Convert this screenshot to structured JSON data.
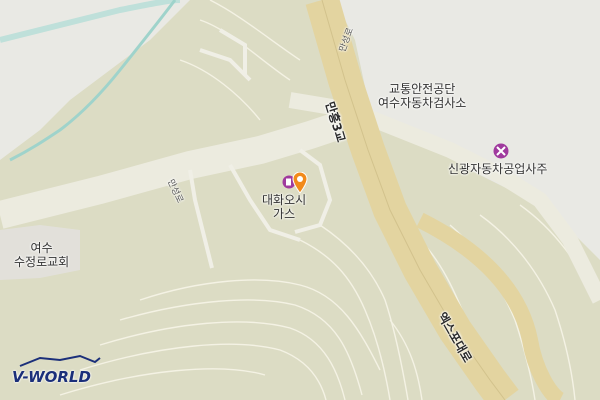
{
  "map": {
    "pois": {
      "agency": {
        "line1": "교통안전공단",
        "line2": "여수자동차검사소"
      },
      "repair": {
        "label": "신광자동차공업사주"
      },
      "gas": {
        "line1": "대화오시",
        "line2": "가스"
      },
      "church": {
        "line1": "여수",
        "line2": "수정로교회"
      }
    },
    "roads": {
      "bridge": "만흥3교",
      "expo": "엑스포대로",
      "mancheong_top": "만성로",
      "mancheong_mid": "만성로"
    },
    "icons": {
      "repair": "wrench-cross-icon",
      "gas": "gas-station-icon",
      "location": "location-pin-icon"
    },
    "colors": {
      "land": "#dcdcc4",
      "urban": "#e9e9e4",
      "water": "#9fd3cb",
      "expressway": "#e3d4a0",
      "minor_road": "#ecebdf",
      "contour": "#f4f2e4",
      "marker": "#f28a1a"
    }
  },
  "logo": {
    "text": "V-WORLD"
  }
}
